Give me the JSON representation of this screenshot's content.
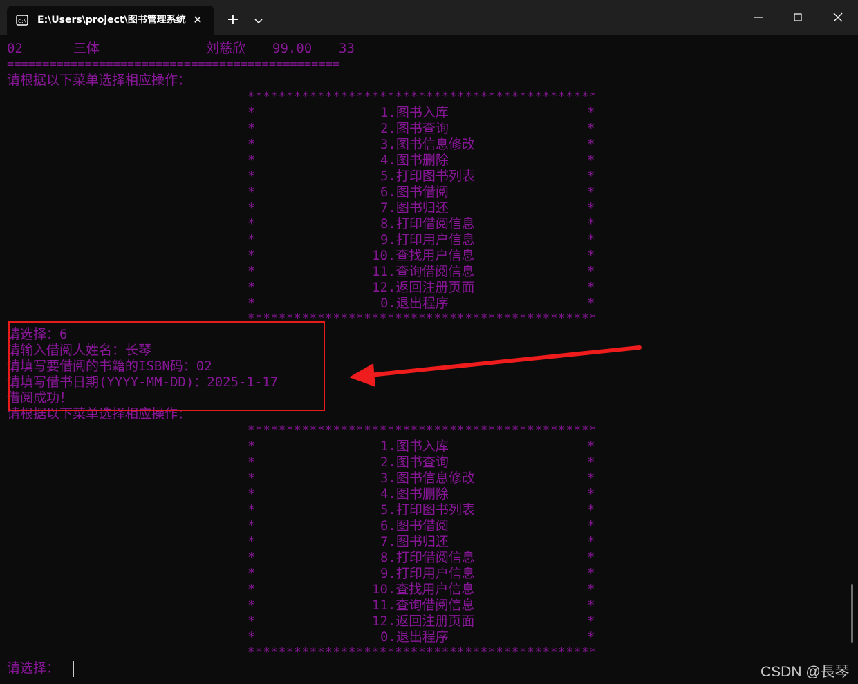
{
  "window": {
    "tab_title": "E:\\Users\\project\\图书管理系统",
    "tab_close": "✕",
    "new_tab": "+",
    "tab_icon": "terminal-icon",
    "dropdown_icon": "chevron-down-icon",
    "minimize_icon": "minimize-icon",
    "maximize_icon": "maximize-icon",
    "close_icon": "close-icon"
  },
  "console": {
    "book_row": {
      "isbn": "02",
      "title": "三体",
      "author": "刘慈欣",
      "price": "99.00",
      "stock": "33"
    },
    "separator": "============================================================",
    "prompt_menu": "请根据以下菜单选择相应操作：",
    "star_border": "**********************************************************************",
    "star_side": "*",
    "menu_items": [
      "1.图书入库",
      "2.图书查询",
      "3.图书信息修改",
      "4.图书删除",
      "5.打印图书列表",
      "6.图书借阅",
      "7.图书归还",
      "8.打印借阅信息",
      "9.打印用户信息",
      "10.查找用户信息",
      "11.查询借阅信息",
      "12.返回注册页面",
      "0.退出程序"
    ],
    "session": {
      "choice_line": "请选择：6",
      "name_line": "请输入借阅人姓名：长琴",
      "isbn_line": "请填写要借阅的书籍的ISBN码：02",
      "date_line": "请填写借书日期(YYYY-MM-DD)：2025-1-17",
      "result_line": "借阅成功！"
    },
    "prompt_menu_2": "请根据以下菜单选择相应操作：",
    "final_prompt": "请选择："
  },
  "annotation": {
    "box_color": "#e61b1b",
    "arrow_color": "#ee1c1c"
  },
  "watermark": "CSDN @長琴",
  "colors": {
    "text": "#881798",
    "background": "#0c0c0c",
    "titlebar": "#202020"
  }
}
